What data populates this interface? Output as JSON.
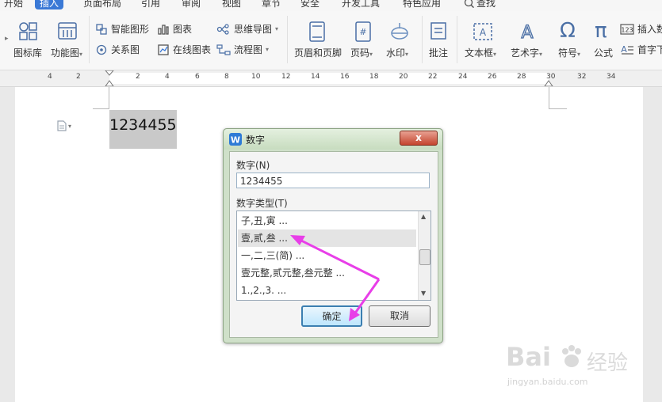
{
  "menubar": {
    "items": [
      "开始",
      "插入",
      "页面布局",
      "引用",
      "审阅",
      "视图",
      "章节",
      "安全",
      "开发工具",
      "特色应用"
    ],
    "active_index": 1,
    "search_label": "查找"
  },
  "ribbon": {
    "icon_library": "图标库",
    "function_chart": "功能图",
    "smart_shape": "智能图形",
    "chart": "图表",
    "relation_chart": "关系图",
    "online_chart": "在线图表",
    "mind_map": "思维导图",
    "flowchart": "流程图",
    "header_footer": "页眉和页脚",
    "page_number": "页码",
    "watermark": "水印",
    "comment": "批注",
    "textbox": "文本框",
    "wordart": "艺术字",
    "symbol": "符号",
    "formula": "公式",
    "insert_number": "插入数",
    "drop_cap": "首字下"
  },
  "ruler": {
    "numbers": [
      "4",
      "2",
      "2",
      "4",
      "6",
      "8",
      "10",
      "12",
      "14",
      "16",
      "18",
      "20",
      "22",
      "24",
      "26",
      "28",
      "30",
      "32",
      "34"
    ]
  },
  "document": {
    "text": "1234455"
  },
  "dialog": {
    "title": "数字",
    "number_label": "数字(N)",
    "number_value": "1234455",
    "type_label": "数字类型(T)",
    "types": [
      "子,丑,寅 ...",
      "壹,贰,叁 ...",
      "一,二,三(简) ...",
      "壹元整,贰元整,叁元整 ...",
      "1.,2.,3. ..."
    ],
    "selected_index": 1,
    "ok_label": "确定",
    "cancel_label": "取消",
    "close_label": "x"
  },
  "watermark": {
    "brand": "Bai",
    "brand_suffix": "经验",
    "url": "jingyan.baidu.com"
  },
  "colors": {
    "arrow": "#e83ee8",
    "accent": "#3a79d6",
    "dialog_frame": "#cfe0c9"
  }
}
